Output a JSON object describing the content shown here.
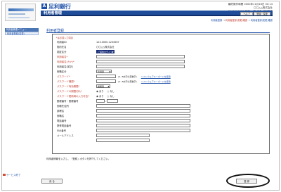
{
  "header": {
    "bank_name": "足利銀行",
    "bank_mark": "A",
    "info_line1": "最終操作時間 0000年11月18日 00:14",
    "info_line2": "〇〇△△株式会社",
    "info_line3": "0000000001 足利 一郎 さま ご利用中",
    "title": "利用者管理",
    "title_buttons": [
      "ヘルプ",
      "登録・変更"
    ]
  },
  "breadcrumb": {
    "items": [
      "利用者登録",
      "利用者登録(変更)確認",
      "利用者登録(変更)確認"
    ],
    "current_index": 1
  },
  "sidebar": {
    "section": "利用者管理メニュー",
    "item": "利用者登録(変更)",
    "footer_link": "サービス終了"
  },
  "main": {
    "section_title": "利用者登録",
    "required_note": "*は必須入力項目",
    "rows": [
      {
        "label": "利用者ID",
        "type": "text",
        "value": "123-0000-1234567"
      },
      {
        "label": "契約先名",
        "type": "text",
        "value": "〇〇△△株式会社"
      },
      {
        "label": "認証区分",
        "type": "select_dark",
        "value": "ご契約ログイン"
      },
      {
        "label": "利用者名*",
        "type": "input",
        "required": true
      },
      {
        "label": "利用者名(カナ)*",
        "type": "input",
        "required": true
      },
      {
        "label": "利用者名(英字)",
        "type": "input"
      },
      {
        "label": "役職区分",
        "type": "select",
        "value": "利用者"
      },
      {
        "label": "パスワード*",
        "type": "input_hint",
        "required": true,
        "hint": "(4~8文字の英数字)",
        "link": "ソフトウェアキーボードを使用"
      },
      {
        "label": "パスワード確認*",
        "type": "input_hint",
        "required": true,
        "hint": "(4~8文字の英数字)",
        "link": "ソフトウェアキーボードを使用"
      },
      {
        "label": "パスワード有効期限*",
        "type": "select",
        "required": true,
        "value": "無期限"
      },
      {
        "label": "パスワードの期限切れ*",
        "type": "radio",
        "required": true,
        "options": [
          "あり",
          "なし"
        ]
      },
      {
        "label": "パスワード更新時の入力可否*",
        "type": "radio",
        "required": true,
        "options": [
          "あり",
          "なし"
        ]
      },
      {
        "label": "郵便番号・郵便番号",
        "type": "zip"
      },
      {
        "label": "勤務先住所",
        "type": "input"
      },
      {
        "label": "部署名",
        "type": "input"
      },
      {
        "label": "役職名",
        "type": "input"
      },
      {
        "label": "電話番号",
        "type": "input"
      },
      {
        "label": "携帯電話番号",
        "type": "input"
      },
      {
        "label": "FAX番号",
        "type": "input"
      },
      {
        "label": "メールアドレス",
        "type": "input"
      },
      {
        "label": "",
        "type": "input"
      }
    ],
    "footer_note": "利用者情報を入力し、「登録」ボタンを押下してください。"
  },
  "actions": {
    "back_label": "戻 る",
    "submit_label": "登 録"
  },
  "colors": {
    "brand_blue": "#1d4fa8",
    "title_bar": "#1f4d9a",
    "required_red": "#c0392b"
  }
}
